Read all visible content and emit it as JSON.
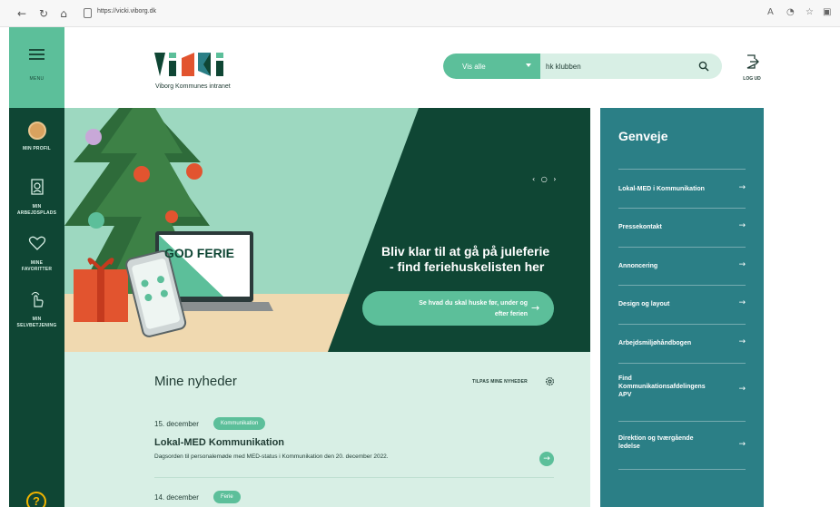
{
  "browser": {
    "url": "https://vicki.viborg.dk"
  },
  "sidebar": {
    "menu_label": "MENU",
    "items": [
      {
        "label_line1": "MIN PROFIL",
        "label_line2": ""
      },
      {
        "label_line1": "MIN",
        "label_line2": "ARBEJDSPLADS"
      },
      {
        "label_line1": "MINE",
        "label_line2": "FAVORITTER"
      },
      {
        "label_line1": "MIN",
        "label_line2": "SELVBETJENING"
      }
    ],
    "help_symbol": "?"
  },
  "header": {
    "logo_text": "VICKI",
    "logo_subtitle": "Viborg Kommunes intranet",
    "search": {
      "scope_value": "Vis alle",
      "query": "hk klubben"
    },
    "logout_label": "LOG UD"
  },
  "hero": {
    "laptop_text": "GOD FERIE",
    "title_line1": "Bliv klar til at gå på juleferie",
    "title_line2": "- find feriehuskelisten her",
    "cta_line1": "Se hvad du skal huske før, under og",
    "cta_line2": "efter ferien",
    "carousel_indicator": "‹ ○ ›"
  },
  "news": {
    "title": "Mine nyheder",
    "tailor_label": "TILPAS MINE NYHEDER",
    "items": [
      {
        "date": "15. december",
        "tag": "Kommunikation",
        "headline": "Lokal-MED Kommunikation",
        "description": "Dagsorden til personalemøde med MED-status i Kommunikation den 20. december 2022."
      },
      {
        "date": "14. december",
        "tag": "Ferie",
        "headline": "",
        "description": ""
      }
    ]
  },
  "shortcuts": {
    "title": "Genveje",
    "items": [
      {
        "line1": "Lokal-MED i Kommunikation",
        "line2": "",
        "line3": ""
      },
      {
        "line1": "Pressekontakt",
        "line2": "",
        "line3": ""
      },
      {
        "line1": "Annoncering",
        "line2": "",
        "line3": ""
      },
      {
        "line1": "Design og layout",
        "line2": "",
        "line3": ""
      },
      {
        "line1": "Arbejdsmiljøhåndbogen",
        "line2": "",
        "line3": ""
      },
      {
        "line1": "Find",
        "line2": "Kommunikationsafdelingens",
        "line3": "APV"
      },
      {
        "line1": "Direktion og tværgående",
        "line2": "ledelse",
        "line3": ""
      }
    ]
  },
  "icons": {
    "back": "back-icon",
    "refresh": "refresh-icon",
    "home": "home-icon",
    "lock": "lock-icon",
    "search": "search-icon",
    "logout": "logout-icon",
    "gear": "gear-icon",
    "arrow": "arrow-right-icon"
  },
  "colors": {
    "dark_green": "#0f4634",
    "mint": "#5cbf9a",
    "light_mint": "#d8efe5",
    "teal": "#2b7f86",
    "help_yellow": "#f0b400"
  }
}
